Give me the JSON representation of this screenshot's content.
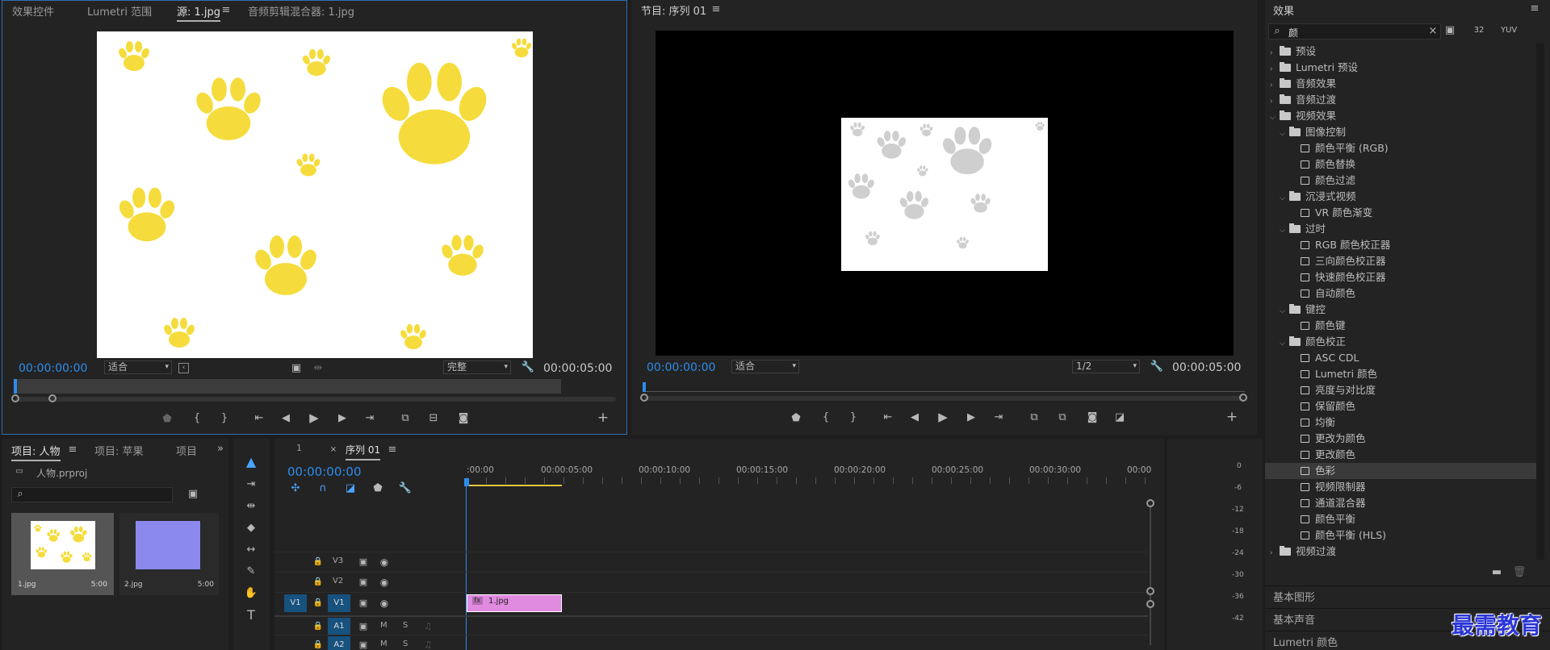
{
  "source_panel": {
    "tabs": [
      "效果控件",
      "Lumetri 范围",
      "源: 1.jpg",
      "音频剪辑混合器: 1.jpg"
    ],
    "timecode": "00:00:00:00",
    "fit": "适合",
    "quality": "完整",
    "duration": "00:00:05:00"
  },
  "program_panel": {
    "title": "节目: 序列 01",
    "timecode": "00:00:00:00",
    "fit": "适合",
    "quality": "1/2",
    "duration": "00:00:05:00"
  },
  "project_panel": {
    "tabs": [
      "项目: 人物",
      "项目: 苹果",
      "项目"
    ],
    "file": "人物.prproj",
    "items": [
      {
        "name": "1.jpg",
        "dur": "5:00"
      },
      {
        "name": "2.jpg",
        "dur": "5:00"
      }
    ]
  },
  "timeline": {
    "tabs": [
      "1",
      "序列 01"
    ],
    "timecode": "00:00:00:00",
    "ruler": [
      ":00:00",
      "00:00:05:00",
      "00:00:10:00",
      "00:00:15:00",
      "00:00:20:00",
      "00:00:25:00",
      "00:00:30:00",
      "00:00"
    ],
    "tracks": [
      {
        "name": "V3"
      },
      {
        "name": "V2"
      },
      {
        "name": "V1",
        "src": "V1"
      },
      {
        "name": "A1",
        "m": "M",
        "s": "S"
      },
      {
        "name": "A2",
        "m": "M",
        "s": "S"
      }
    ],
    "clip": "1.jpg",
    "fx": "fx"
  },
  "meter": {
    "labels": [
      "0",
      "-6",
      "-12",
      "-18",
      "-24",
      "-30",
      "-36",
      "-42"
    ]
  },
  "effects_panel": {
    "title": "效果",
    "search": "颜",
    "tree": [
      {
        "l": 0,
        "t": "preset",
        "x": "预设"
      },
      {
        "l": 0,
        "t": "preset",
        "x": "Lumetri 预设"
      },
      {
        "l": 0,
        "t": "f",
        "x": "音频效果"
      },
      {
        "l": 0,
        "t": "f",
        "x": "音频过渡"
      },
      {
        "l": 0,
        "t": "fo",
        "x": "视频效果"
      },
      {
        "l": 1,
        "t": "fo",
        "x": "图像控制"
      },
      {
        "l": 2,
        "t": "e",
        "x": "颜色平衡 (RGB)"
      },
      {
        "l": 2,
        "t": "e",
        "x": "颜色替换"
      },
      {
        "l": 2,
        "t": "e",
        "x": "颜色过滤"
      },
      {
        "l": 1,
        "t": "fo",
        "x": "沉浸式视频"
      },
      {
        "l": 2,
        "t": "e",
        "x": "VR 颜色渐变"
      },
      {
        "l": 1,
        "t": "fo",
        "x": "过时"
      },
      {
        "l": 2,
        "t": "e",
        "x": "RGB 颜色校正器"
      },
      {
        "l": 2,
        "t": "e",
        "x": "三向颜色校正器"
      },
      {
        "l": 2,
        "t": "e",
        "x": "快速颜色校正器"
      },
      {
        "l": 2,
        "t": "e",
        "x": "自动颜色"
      },
      {
        "l": 1,
        "t": "fo",
        "x": "键控"
      },
      {
        "l": 2,
        "t": "e",
        "x": "颜色键"
      },
      {
        "l": 1,
        "t": "fo",
        "x": "颜色校正"
      },
      {
        "l": 2,
        "t": "e",
        "x": "ASC CDL"
      },
      {
        "l": 2,
        "t": "e",
        "x": "Lumetri 颜色"
      },
      {
        "l": 2,
        "t": "e",
        "x": "亮度与对比度"
      },
      {
        "l": 2,
        "t": "e",
        "x": "保留颜色"
      },
      {
        "l": 2,
        "t": "e",
        "x": "均衡"
      },
      {
        "l": 2,
        "t": "e",
        "x": "更改为颜色"
      },
      {
        "l": 2,
        "t": "e",
        "x": "更改颜色"
      },
      {
        "l": 2,
        "t": "e",
        "x": "色彩",
        "sel": true
      },
      {
        "l": 2,
        "t": "e",
        "x": "视频限制器"
      },
      {
        "l": 2,
        "t": "e",
        "x": "通道混合器"
      },
      {
        "l": 2,
        "t": "e",
        "x": "颜色平衡"
      },
      {
        "l": 2,
        "t": "e",
        "x": "颜色平衡 (HLS)"
      },
      {
        "l": 0,
        "t": "f",
        "x": "视频过渡"
      }
    ],
    "bottom": [
      "基本图形",
      "基本声音",
      "Lumetri 颜色"
    ]
  },
  "watermark": "最需教育"
}
